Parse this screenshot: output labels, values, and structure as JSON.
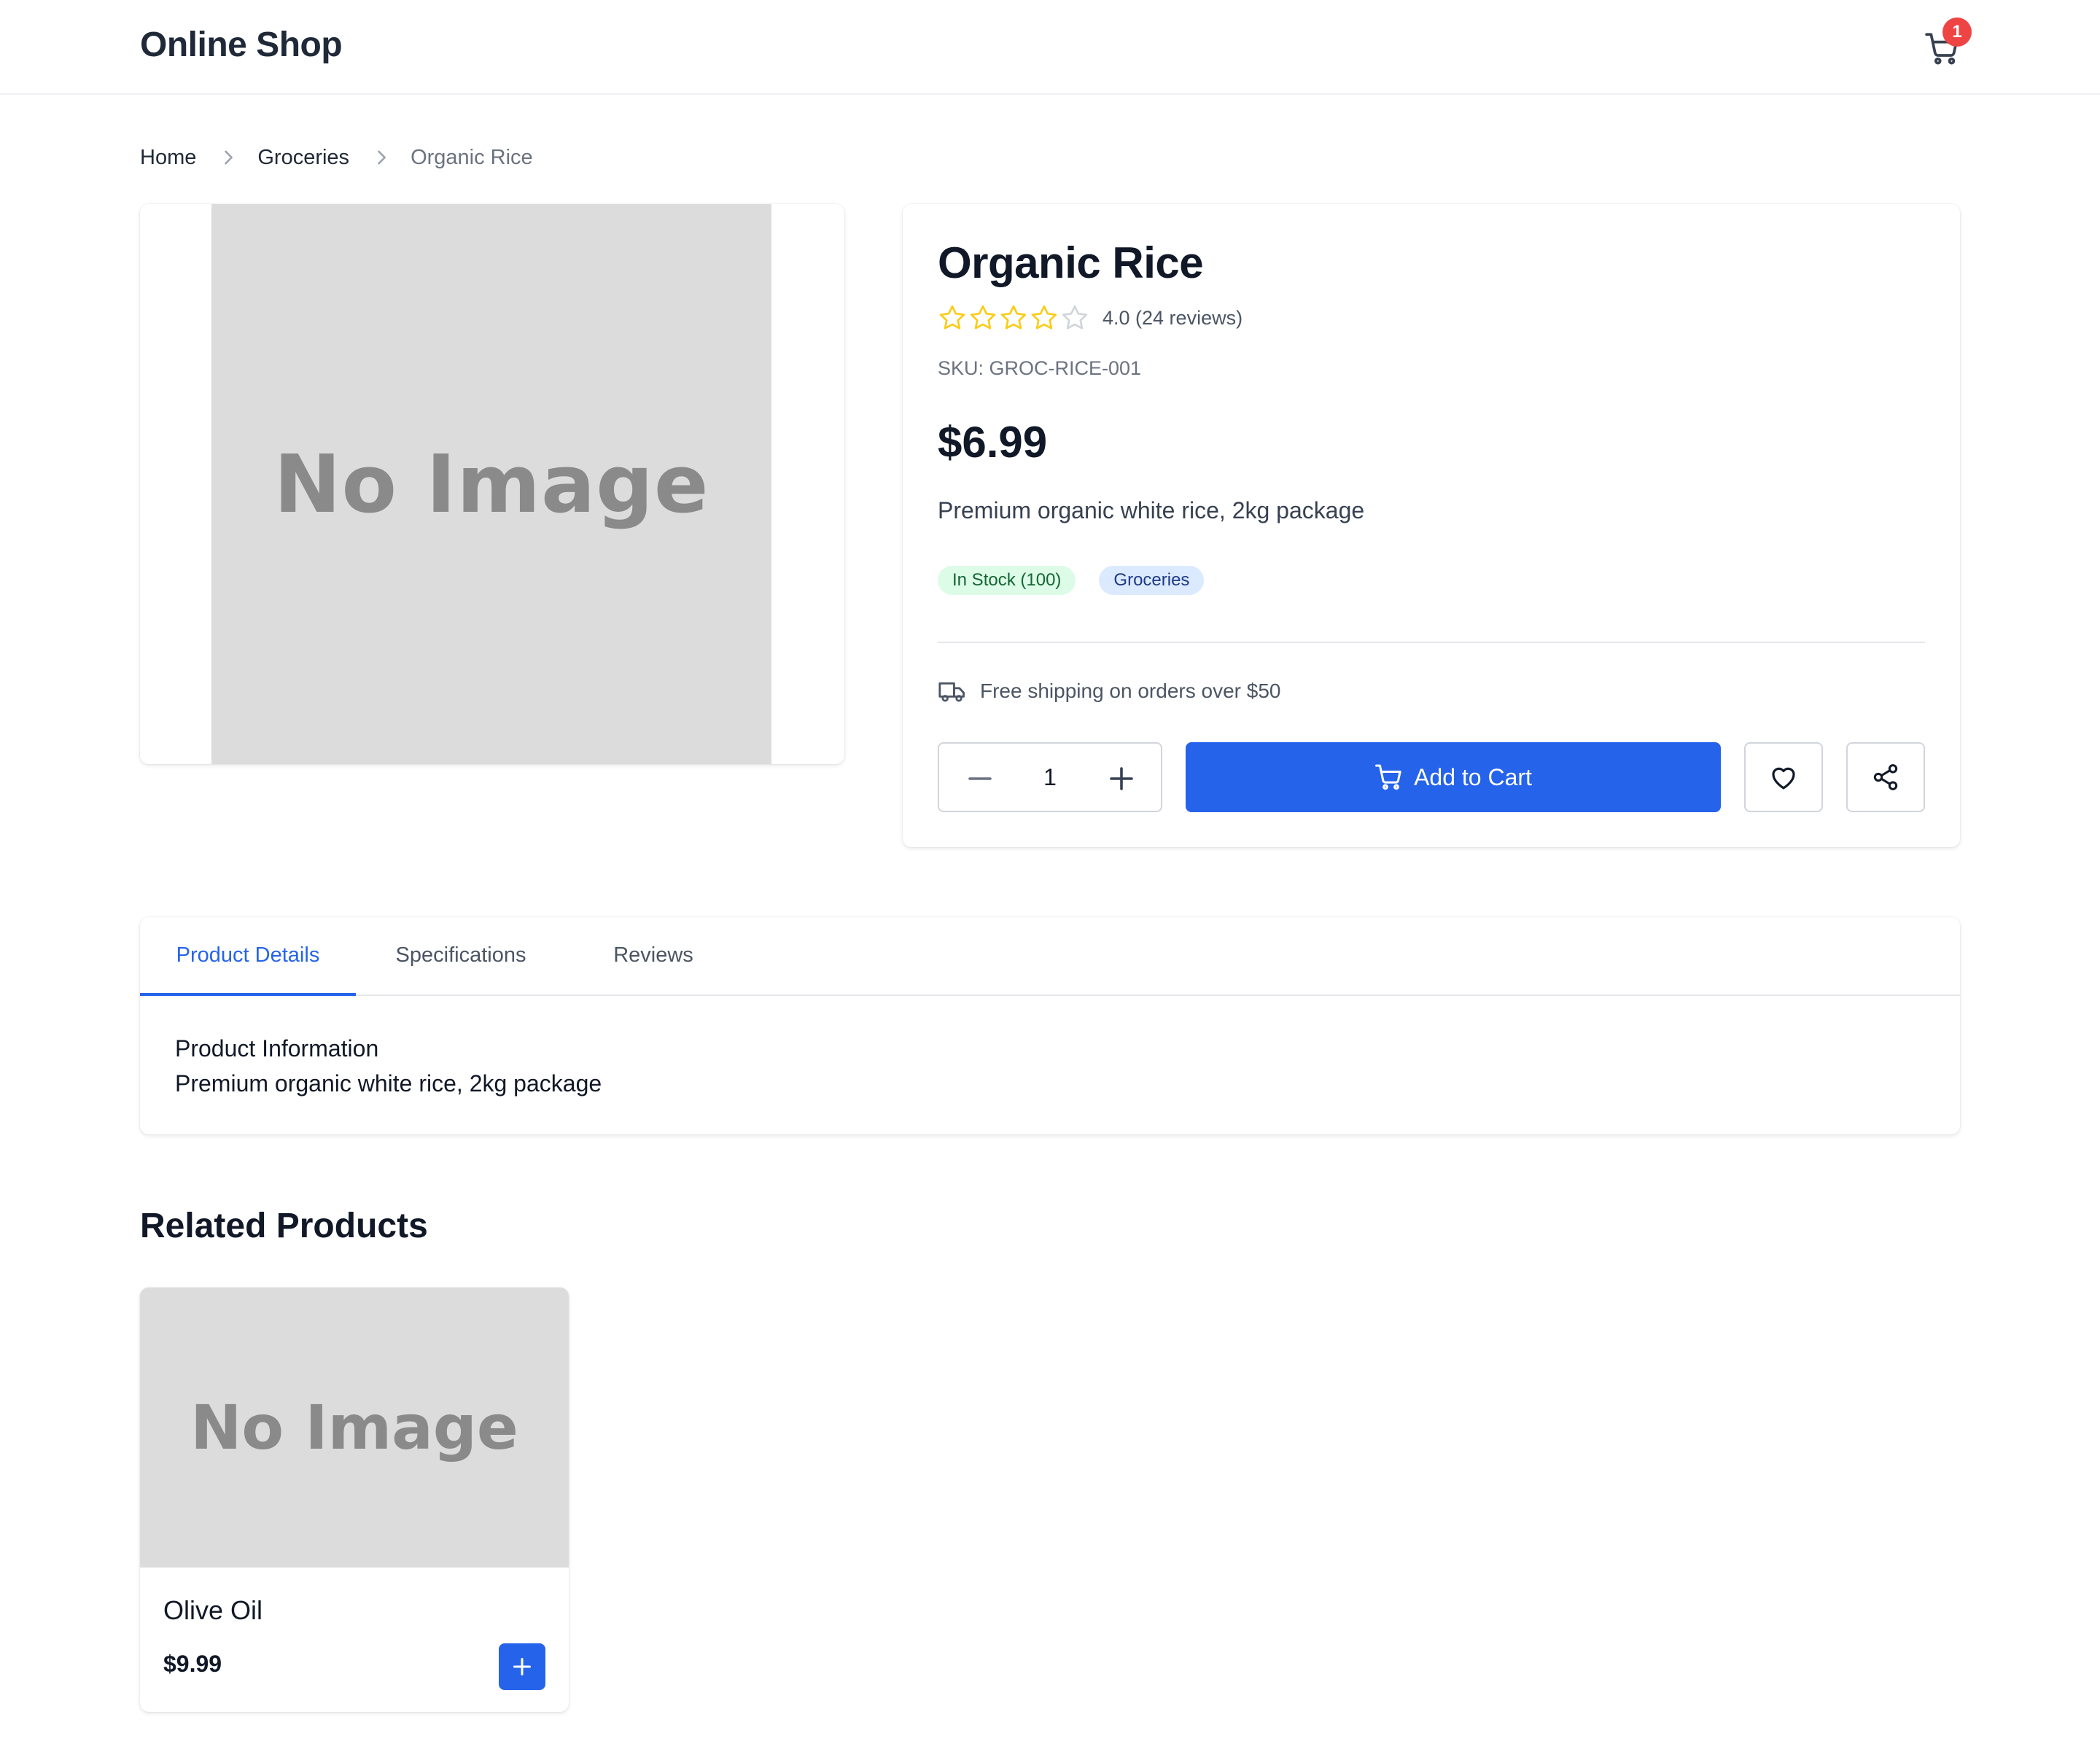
{
  "header": {
    "brand": "Online Shop",
    "cart_count": "1"
  },
  "breadcrumb": {
    "items": [
      "Home",
      "Groceries",
      "Organic Rice"
    ]
  },
  "product": {
    "image_placeholder": "No Image",
    "title": "Organic Rice",
    "rating": 4.0,
    "rating_text": "4.0 (24 reviews)",
    "sku": "SKU: GROC-RICE-001",
    "price": "$6.99",
    "description": "Premium organic white rice, 2kg package",
    "stock_badge": "In Stock (100)",
    "category_badge": "Groceries",
    "shipping_note": "Free shipping on orders over $50",
    "quantity": "1",
    "add_to_cart_label": "Add to Cart"
  },
  "tabs": {
    "items": [
      "Product Details",
      "Specifications",
      "Reviews"
    ],
    "active": "Product Details",
    "content_heading": "Product Information",
    "content_body": "Premium organic white rice, 2kg package"
  },
  "related": {
    "title": "Related Products",
    "products": [
      {
        "image_placeholder": "No Image",
        "name": "Olive Oil",
        "price": "$9.99"
      }
    ]
  },
  "colors": {
    "accent": "#2563eb",
    "badge_red": "#ef4444",
    "star": "#facc15",
    "stock_bg": "#dcfce7",
    "category_bg": "#dbeafe"
  }
}
